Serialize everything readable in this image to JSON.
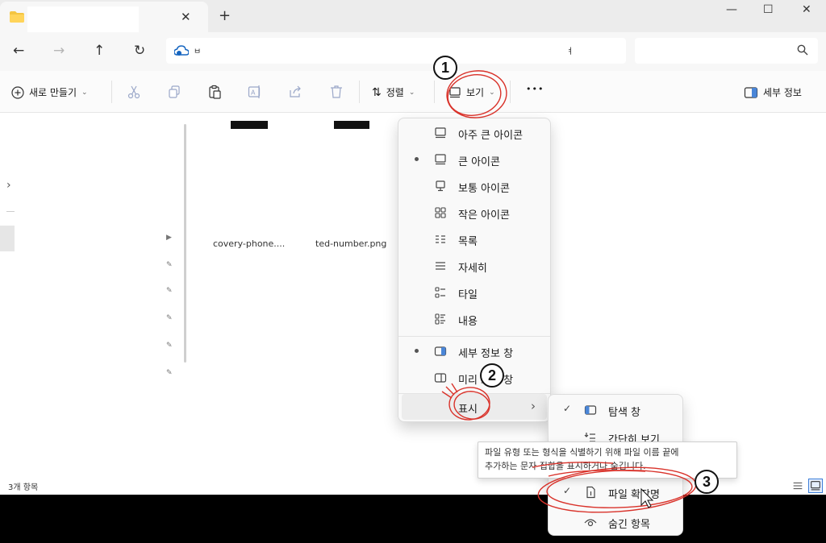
{
  "window": {
    "tab_close": "✕",
    "new_tab": "+",
    "minimize": "—",
    "maximize": "☐",
    "close": "✕"
  },
  "nav": {
    "back": "←",
    "forward": "→",
    "up": "↑",
    "refresh": "↻"
  },
  "address": {
    "text": "ㅂ",
    "end": "ㅕ"
  },
  "toolbar": {
    "new": "새로 만들기",
    "sort": "정렬",
    "view": "보기",
    "more": "•••",
    "details": "세부 정보"
  },
  "files": [
    {
      "label": "covery-phone...."
    },
    {
      "label": "ted-number.png"
    }
  ],
  "view_menu": {
    "items": [
      {
        "label": "아주 큰 아이콘",
        "icon": "monitor-icon",
        "selected": false
      },
      {
        "label": "큰 아이콘",
        "icon": "monitor-icon",
        "selected": true
      },
      {
        "label": "보통 아이콘",
        "icon": "small-monitor-icon",
        "selected": false
      },
      {
        "label": "작은 아이콘",
        "icon": "grid-icon",
        "selected": false
      },
      {
        "label": "목록",
        "icon": "list-icon",
        "selected": false
      },
      {
        "label": "자세히",
        "icon": "details-icon",
        "selected": false
      },
      {
        "label": "타일",
        "icon": "tiles-icon",
        "selected": false
      },
      {
        "label": "내용",
        "icon": "content-icon",
        "selected": false
      }
    ],
    "panes": [
      {
        "label": "세부 정보 창",
        "selected": true
      },
      {
        "label": "미리 보기 창",
        "selected": false
      }
    ],
    "show": {
      "label": "표시",
      "arrow": "›"
    }
  },
  "show_menu": {
    "items": [
      {
        "label": "탐색 창",
        "checked": true
      },
      {
        "label": "간단히 보기",
        "checked": false
      },
      {
        "label": "파일 확장명",
        "checked": true
      },
      {
        "label": "숨긴 항목",
        "checked": false
      }
    ],
    "check": "✓"
  },
  "tooltip": {
    "line1": "파일 유형 또는 형식을 식별하기 위해 파일 이름 끝에",
    "line2": "추가하는 문자 집합을 표시하거나 숨깁니다."
  },
  "status": {
    "count": "3개 항목"
  },
  "annotations": [
    "1",
    "2",
    "3"
  ],
  "colors": {
    "accent": "#3b7dd8",
    "annotation_red": "#d9322a"
  }
}
